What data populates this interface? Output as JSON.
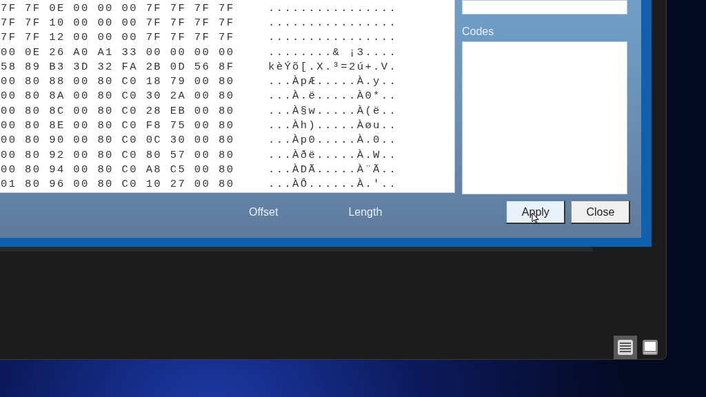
{
  "hex_view": {
    "rows": [
      {
        "hex": "7F 7F 0E 00 00 00 7F 7F 7F 7F",
        "ascii": "................"
      },
      {
        "hex": "7F 7F 10 00 00 00 7F 7F 7F 7F",
        "ascii": "................"
      },
      {
        "hex": "7F 7F 12 00 00 00 7F 7F 7F 7F",
        "ascii": "................"
      },
      {
        "hex": "00 0E 26 A0 A1 33 00 00 00 00",
        "ascii": "........& ¡3...."
      },
      {
        "hex": "58 89 B3 3D 32 FA 2B 0D 56 8F",
        "ascii": "kèÝõ[.X.³=2ú+.V."
      },
      {
        "hex": "00 80 88 00 80 C0 18 79 00 80",
        "ascii": "...ÀpÆ.....À.y.."
      },
      {
        "hex": "00 80 8A 00 80 C0 30 2A 00 80",
        "ascii": "...À.ë.....À0*.."
      },
      {
        "hex": "00 80 8C 00 80 C0 28 EB 00 80",
        "ascii": "...À§w.....À(ë.."
      },
      {
        "hex": "00 80 8E 00 80 C0 F8 75 00 80",
        "ascii": "...Àh).....Àøu.."
      },
      {
        "hex": "00 80 90 00 80 C0 0C 30 00 80",
        "ascii": "...Àp0.....À.0.."
      },
      {
        "hex": "00 80 92 00 80 C0 80 57 00 80",
        "ascii": "...Àðë.....À.W.."
      },
      {
        "hex": "00 80 94 00 80 C0 A8 C5 00 80",
        "ascii": "...ÀDÃ.....À¨Ã.."
      },
      {
        "hex": "01 80 96 00 80 C0 10 27 00 80",
        "ascii": "...ÀÔ......À.'.."
      }
    ]
  },
  "codes_label": "Codes",
  "footer_labels": [
    "Offset",
    "Length"
  ],
  "buttons": [
    {
      "label": "Apply",
      "hovered": true
    },
    {
      "label": "Close",
      "hovered": false
    }
  ],
  "view_toggles": [
    {
      "kind": "list",
      "selected": true
    },
    {
      "kind": "window",
      "selected": false
    }
  ]
}
